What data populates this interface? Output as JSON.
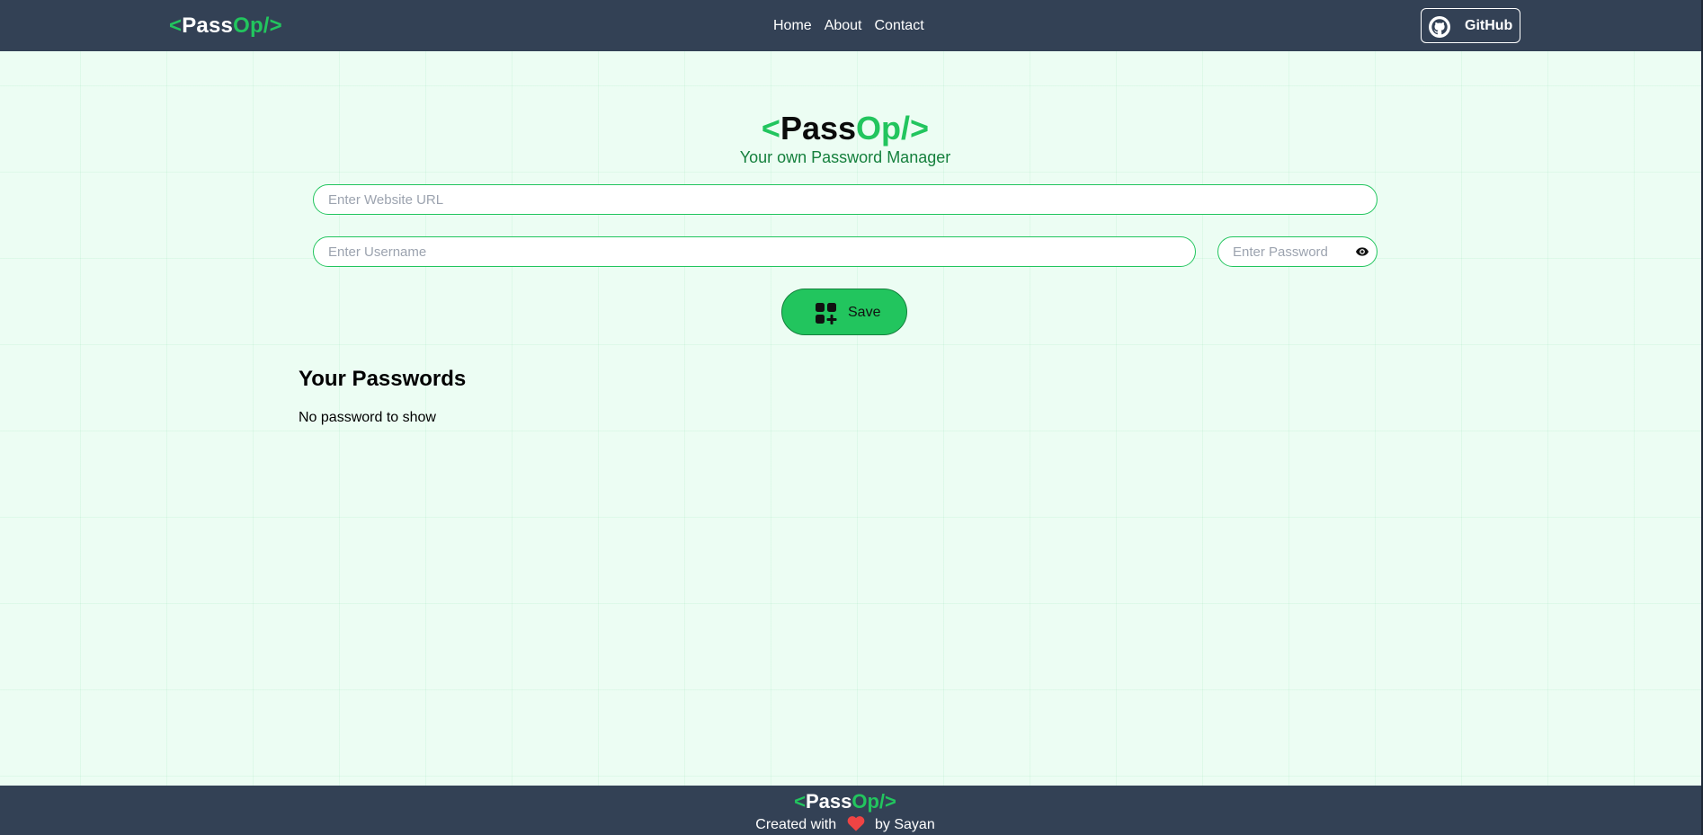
{
  "navbar": {
    "logo": {
      "open": "<",
      "pass": "Pass",
      "op": "Op/>"
    },
    "links": [
      "Home",
      "About",
      "Contact"
    ],
    "github_label": "GitHub"
  },
  "hero": {
    "logo": {
      "open": "<",
      "pass": "Pass",
      "op": "Op/>"
    },
    "tagline": "Your own Password Manager"
  },
  "form": {
    "url_placeholder": "Enter Website URL",
    "username_placeholder": "Enter Username",
    "password_placeholder": "Enter Password",
    "url_value": "",
    "username_value": "",
    "password_value": "",
    "save_label": "Save"
  },
  "passwords": {
    "title": "Your Passwords",
    "empty_message": "No password to show"
  },
  "footer": {
    "logo": {
      "open": "<",
      "pass": "Pass",
      "op": "Op/>"
    },
    "credit_prefix": "Created with",
    "credit_suffix": "by Sayan"
  },
  "icons": {
    "github": "github-icon",
    "eye": "eye-icon",
    "save": "add-grid-icon",
    "heart": "heart-icon"
  },
  "colors": {
    "nav_bg": "#334155",
    "accent": "#22c55e",
    "accent_dark": "#15803d",
    "page_bg": "#ecfdf3",
    "heart": "#ef4444"
  }
}
